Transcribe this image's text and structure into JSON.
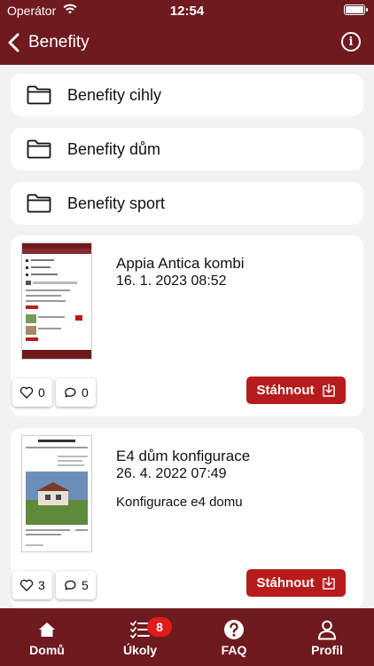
{
  "status_bar": {
    "carrier": "Operátor",
    "time": "12:54"
  },
  "header": {
    "back_label": "Benefity",
    "info_icon": "info-icon"
  },
  "folders": [
    {
      "label": "Benefity cihly",
      "icon": "folder-icon"
    },
    {
      "label": "Benefity dům",
      "icon": "folder-icon"
    },
    {
      "label": "Benefity sport",
      "icon": "folder-icon"
    }
  ],
  "documents": [
    {
      "title": "Appia Antica kombi",
      "date": "16. 1. 2023 08:52",
      "description": "",
      "likes": "0",
      "comments": "0",
      "download_label": "Stáhnout"
    },
    {
      "title": "E4 dům konfigurace",
      "date": "26. 4. 2022 07:49",
      "description": "Konfigurace e4 domu",
      "likes": "3",
      "comments": "5",
      "download_label": "Stáhnout"
    }
  ],
  "tabs": [
    {
      "label": "Domů",
      "icon": "home-icon"
    },
    {
      "label": "Úkoly",
      "icon": "checklist-icon",
      "badge": "8"
    },
    {
      "label": "FAQ",
      "icon": "question-icon"
    },
    {
      "label": "Profil",
      "icon": "person-icon"
    }
  ],
  "colors": {
    "primary": "#6e1a1f",
    "accent": "#b71c1c",
    "badge": "#e21a1a",
    "background": "#f2f2f2"
  }
}
